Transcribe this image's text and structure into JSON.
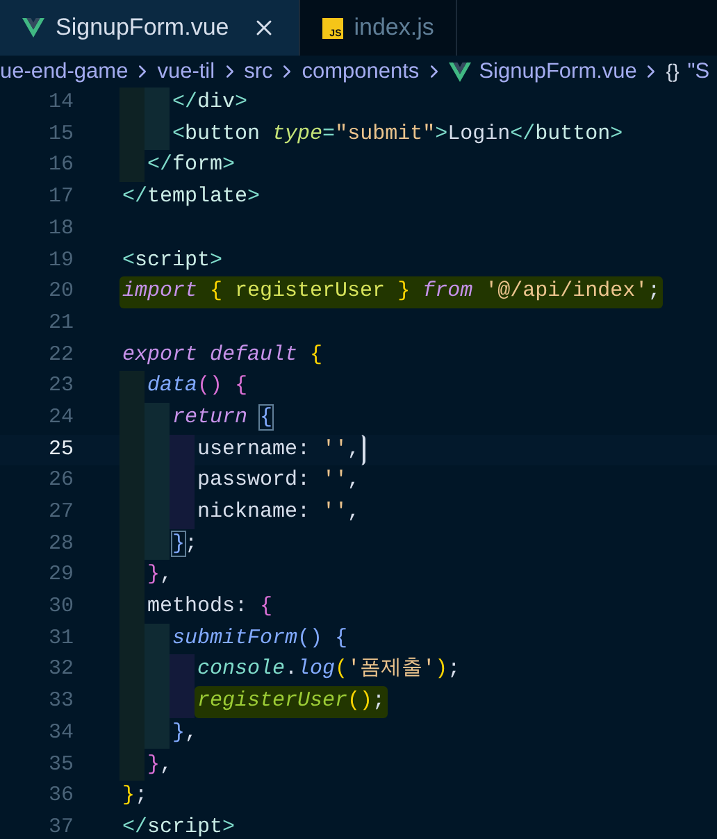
{
  "tabs": [
    {
      "label": "SignupForm.vue",
      "kind": "vue",
      "selected": true,
      "closable": true
    },
    {
      "label": "index.js",
      "kind": "js",
      "icon_label": "JS",
      "selected": false,
      "closable": false
    }
  ],
  "breadcrumb": [
    {
      "label": "ue-end-game",
      "kind": "folder"
    },
    {
      "label": "vue-til",
      "kind": "folder"
    },
    {
      "label": "src",
      "kind": "folder"
    },
    {
      "label": "components",
      "kind": "folder"
    },
    {
      "label": "SignupForm.vue",
      "kind": "vue"
    },
    {
      "label": "\"S",
      "kind": "object",
      "icon_text": "{}"
    }
  ],
  "lines": [
    {
      "num": "14",
      "current": false,
      "highlighted": false,
      "tokens": [
        {
          "text": "    </",
          "kind": "tagp"
        },
        {
          "text": "div",
          "kind": "tag"
        },
        {
          "text": ">",
          "kind": "tagp"
        }
      ]
    },
    {
      "num": "15",
      "current": false,
      "highlighted": false,
      "tokens": [
        {
          "text": "    <",
          "kind": "tagp"
        },
        {
          "text": "button ",
          "kind": "tag"
        },
        {
          "text": "type",
          "kind": "attr"
        },
        {
          "text": "=",
          "kind": "tagp"
        },
        {
          "text": "\"submit\"",
          "kind": "string"
        },
        {
          "text": ">",
          "kind": "tagp"
        },
        {
          "text": "Login",
          "kind": "plain"
        },
        {
          "text": "</",
          "kind": "tagp"
        },
        {
          "text": "button",
          "kind": "tag"
        },
        {
          "text": ">",
          "kind": "tagp"
        }
      ]
    },
    {
      "num": "16",
      "current": false,
      "highlighted": false,
      "tokens": [
        {
          "text": "  </",
          "kind": "tagp"
        },
        {
          "text": "form",
          "kind": "tag"
        },
        {
          "text": ">",
          "kind": "tagp"
        }
      ]
    },
    {
      "num": "17",
      "current": false,
      "highlighted": false,
      "tokens": [
        {
          "text": "</",
          "kind": "tagp"
        },
        {
          "text": "template",
          "kind": "tag"
        },
        {
          "text": ">",
          "kind": "tagp"
        }
      ]
    },
    {
      "num": "18",
      "current": false
    },
    {
      "num": "19",
      "current": false,
      "highlighted": false,
      "tokens": [
        {
          "text": "<",
          "kind": "tagp"
        },
        {
          "text": "script",
          "kind": "tag"
        },
        {
          "text": ">",
          "kind": "tagp"
        }
      ]
    },
    {
      "num": "20",
      "current": false,
      "highlighted": true,
      "tokens": [
        {
          "text": "import ",
          "kind": "keyword"
        },
        {
          "text": "{ ",
          "kind": "bracket1"
        },
        {
          "text": "registerUser ",
          "kind": "import"
        },
        {
          "text": "} ",
          "kind": "bracket1"
        },
        {
          "text": "from ",
          "kind": "keyword"
        },
        {
          "text": "'@/api/index'",
          "kind": "string"
        },
        {
          "text": ";",
          "kind": "plain"
        }
      ]
    },
    {
      "num": "21",
      "current": false
    },
    {
      "num": "22",
      "current": false,
      "highlighted": false,
      "tokens": [
        {
          "text": "export default ",
          "kind": "keyword"
        },
        {
          "text": "{",
          "kind": "bracket1"
        }
      ]
    },
    {
      "num": "23",
      "current": false,
      "highlighted": false,
      "tokens": [
        {
          "text": "  data",
          "kind": "func"
        },
        {
          "text": "() ",
          "kind": "bracket2"
        },
        {
          "text": "{",
          "kind": "bracket2"
        }
      ]
    },
    {
      "num": "24",
      "current": false,
      "highlighted": false,
      "tokens": [
        {
          "text": "    return ",
          "kind": "keyword"
        },
        {
          "text": "{",
          "kind": "bracket3",
          "matched": true
        }
      ]
    },
    {
      "num": "25",
      "current": true,
      "highlighted": false,
      "tokens": [
        {
          "text": "      username",
          "kind": "plain"
        },
        {
          "text": ": ",
          "kind": "plain"
        },
        {
          "text": "''",
          "kind": "string"
        },
        {
          "text": ",",
          "kind": "plain"
        }
      ]
    },
    {
      "num": "26",
      "current": false,
      "highlighted": false,
      "tokens": [
        {
          "text": "      password",
          "kind": "plain"
        },
        {
          "text": ": ",
          "kind": "plain"
        },
        {
          "text": "''",
          "kind": "string"
        },
        {
          "text": ",",
          "kind": "plain"
        }
      ]
    },
    {
      "num": "27",
      "current": false,
      "highlighted": false,
      "tokens": [
        {
          "text": "      nickname",
          "kind": "plain"
        },
        {
          "text": ": ",
          "kind": "plain"
        },
        {
          "text": "''",
          "kind": "string"
        },
        {
          "text": ",",
          "kind": "plain"
        }
      ]
    },
    {
      "num": "28",
      "current": false,
      "highlighted": false,
      "tokens": [
        {
          "text": "    }",
          "kind": "bracket3",
          "matched": true
        },
        {
          "text": ";",
          "kind": "plain"
        }
      ]
    },
    {
      "num": "29",
      "current": false,
      "highlighted": false,
      "tokens": [
        {
          "text": "  }",
          "kind": "bracket2"
        },
        {
          "text": ",",
          "kind": "plain"
        }
      ]
    },
    {
      "num": "30",
      "current": false,
      "highlighted": false,
      "tokens": [
        {
          "text": "  methods",
          "kind": "plain"
        },
        {
          "text": ": ",
          "kind": "plain"
        },
        {
          "text": "{",
          "kind": "bracket2"
        }
      ]
    },
    {
      "num": "31",
      "current": false,
      "highlighted": false,
      "tokens": [
        {
          "text": "    submitForm",
          "kind": "func"
        },
        {
          "text": "() ",
          "kind": "bracket3"
        },
        {
          "text": "{",
          "kind": "bracket3"
        }
      ]
    },
    {
      "num": "32",
      "current": false,
      "highlighted": false,
      "tokens": [
        {
          "text": "      console",
          "kind": "console"
        },
        {
          "text": ".",
          "kind": "plain"
        },
        {
          "text": "log",
          "kind": "func"
        },
        {
          "text": "(",
          "kind": "bracket1"
        },
        {
          "text": "'폼제출'",
          "kind": "string"
        },
        {
          "text": ")",
          "kind": "bracket1"
        },
        {
          "text": ";",
          "kind": "plain"
        }
      ]
    },
    {
      "num": "33",
      "current": false,
      "highlighted": true,
      "tokens": [
        {
          "text": "      registerUser",
          "kind": "call"
        },
        {
          "text": "()",
          "kind": "bracket1"
        },
        {
          "text": ";",
          "kind": "plain"
        }
      ]
    },
    {
      "num": "34",
      "current": false,
      "highlighted": false,
      "tokens": [
        {
          "text": "    }",
          "kind": "bracket3"
        },
        {
          "text": ",",
          "kind": "plain"
        }
      ]
    },
    {
      "num": "35",
      "current": false,
      "highlighted": false,
      "tokens": [
        {
          "text": "  }",
          "kind": "bracket2"
        },
        {
          "text": ",",
          "kind": "plain"
        }
      ]
    },
    {
      "num": "36",
      "current": false,
      "highlighted": false,
      "tokens": [
        {
          "text": "}",
          "kind": "bracket1"
        },
        {
          "text": ";",
          "kind": "plain"
        }
      ]
    },
    {
      "num": "37",
      "current": false,
      "highlighted": false,
      "tokens": [
        {
          "text": "</",
          "kind": "tagp"
        },
        {
          "text": "script",
          "kind": "tag"
        },
        {
          "text": ">",
          "kind": "tagp"
        }
      ]
    }
  ]
}
